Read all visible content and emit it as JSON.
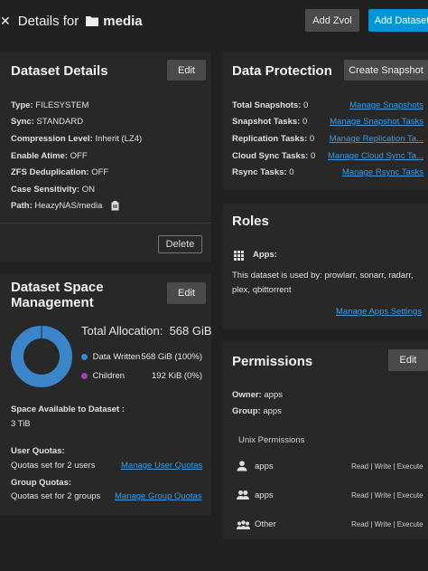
{
  "header": {
    "back_icon": "close-icon",
    "title_prefix": "Details for",
    "folder_icon": "folder-icon",
    "dataset_name": "media",
    "add_zvol": "Add Zvol",
    "add_dataset": "Add Dataset"
  },
  "details": {
    "title": "Dataset Details",
    "edit": "Edit",
    "type_label": "Type:",
    "type_value": "FILESYSTEM",
    "sync_label": "Sync:",
    "sync_value": "STANDARD",
    "compression_label": "Compression Level:",
    "compression_value": "Inherit (LZ4)",
    "atime_label": "Enable Atime:",
    "atime_value": "OFF",
    "dedup_label": "ZFS Deduplication:",
    "dedup_value": "OFF",
    "case_label": "Case Sensitivity:",
    "case_value": "ON",
    "path_label": "Path:",
    "path_value": "HeazyNAS/media",
    "delete": "Delete"
  },
  "space": {
    "title_line1": "Dataset Space",
    "title_line2": "Management",
    "edit": "Edit",
    "total_label": "Total Allocation:",
    "total_value": "568 GiB",
    "legend": [
      {
        "label": "Data Written",
        "value": "568 GiB (100%)",
        "color": "#3a86c8"
      },
      {
        "label": "Children",
        "value": "192 KiB (0%)",
        "color": "#a73fb8"
      }
    ],
    "available_label": "Space Available to Dataset :",
    "available_value": "3 TiB",
    "user_quotas_label": "User Quotas:",
    "user_quotas_text": "Quotas set for 2 users",
    "user_quotas_link": "Manage User Quotas",
    "group_quotas_label": "Group Quotas:",
    "group_quotas_text": "Quotas set for 2 groups",
    "group_quotas_link": "Manage Group Quotas"
  },
  "chart_data": {
    "type": "pie",
    "categories": [
      "Data Written",
      "Children"
    ],
    "values": [
      100,
      0
    ],
    "colors": [
      "#3a86c8",
      "#a73fb8"
    ]
  },
  "protection": {
    "title": "Data Protection",
    "create_snapshot": "Create Snapshot",
    "rows": [
      {
        "label": "Total Snapshots:",
        "value": "0",
        "link": "Manage Snapshots"
      },
      {
        "label": "Snapshot Tasks:",
        "value": "0",
        "link": "Manage Snapshot Tasks"
      },
      {
        "label": "Replication Tasks:",
        "value": "0",
        "link": "Manage Replication Ta..."
      },
      {
        "label": "Cloud Sync Tasks:",
        "value": "0",
        "link": "Manage Cloud Sync Ta..."
      },
      {
        "label": "Rsync Tasks:",
        "value": "0",
        "link": "Manage Rsync Tasks"
      }
    ]
  },
  "roles": {
    "title": "Roles",
    "apps_icon": "apps-grid-icon",
    "apps_label": "Apps:",
    "used_by_line1": "This dataset is used by: prowlarr, sonarr, radarr,",
    "used_by_line2": "plex, qbittorrent",
    "manage_link": "Manage Apps Settings"
  },
  "permissions": {
    "title": "Permissions",
    "edit": "Edit",
    "owner_label": "Owner:",
    "owner_value": "apps",
    "group_label": "Group:",
    "group_value": "apps",
    "unix_title": "Unix Permissions",
    "entries": [
      {
        "icon": "user-icon",
        "name": "apps",
        "perms": "Read | Write | Execute"
      },
      {
        "icon": "group-icon",
        "name": "apps",
        "perms": "Read | Write | Execute"
      },
      {
        "icon": "others-icon",
        "name": "Other",
        "perms": "Read | Write | Execute"
      }
    ]
  }
}
